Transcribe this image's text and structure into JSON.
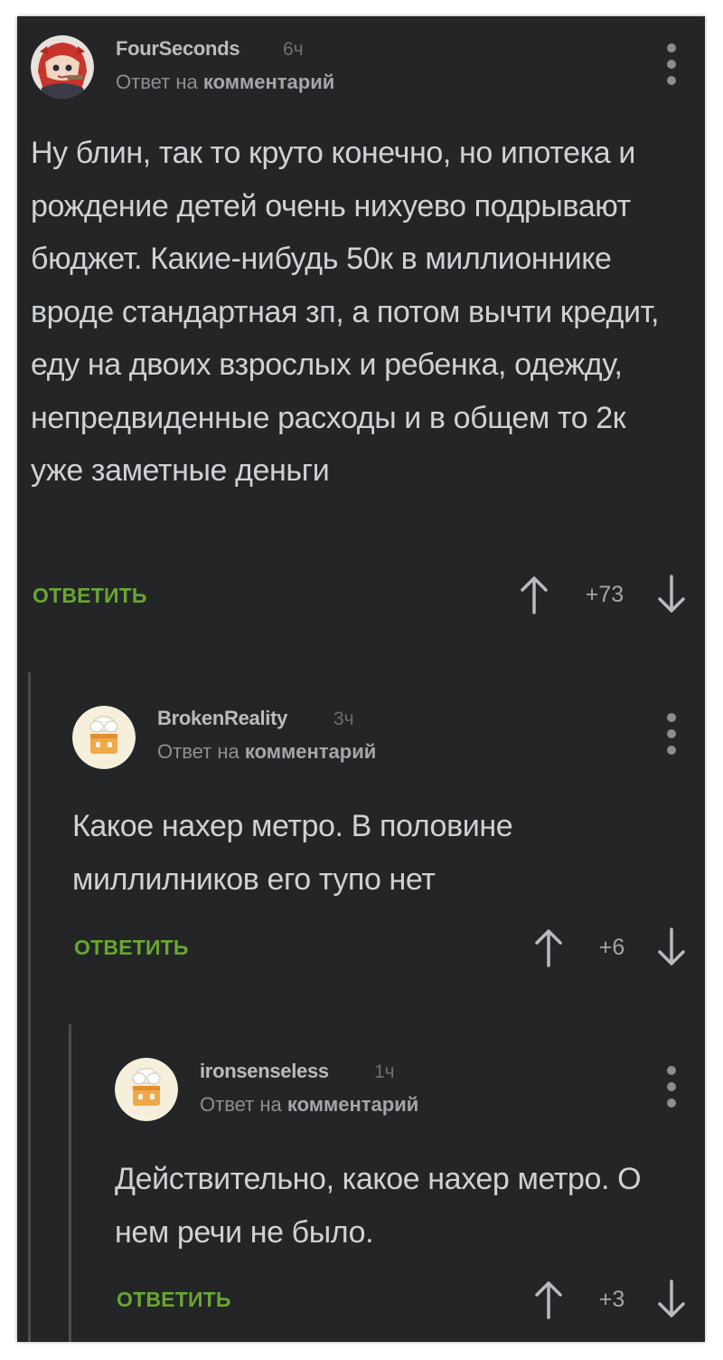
{
  "comments": [
    {
      "username": "FourSeconds",
      "time": "6ч",
      "reply_prefix": "Ответ на",
      "reply_target": "комментарий",
      "text": "Ну блин, так то круто конечно, но ипотека и рождение детей очень нихуево подрывают бюджет. Какие-нибудь 50к в миллионнике вроде стандартная зп, а потом вычти кредит,  еду на двоих взрослых и ребенка, одежду, непредвиденные расходы и в общем то 2к уже заметные деньги",
      "reply_label": "ОТВЕТИТЬ",
      "score": "+73",
      "avatar": "anime-avatar-icon"
    },
    {
      "username": "BrokenReality",
      "time": "3ч",
      "reply_prefix": "Ответ на",
      "reply_target": "комментарий",
      "text": "Какое нахер метро. В половине миллилников его тупо нет",
      "reply_label": "ОТВЕТИТЬ",
      "score": "+6",
      "avatar": "default-avatar-icon"
    },
    {
      "username": "ironsenseless",
      "time": "1ч",
      "reply_prefix": "Ответ на",
      "reply_target": "комментарий",
      "text": "Действительно, какое нахер метро. О нем речи не было.",
      "reply_label": "ОТВЕТИТЬ",
      "score": "+3",
      "avatar": "default-avatar-icon"
    }
  ],
  "colors": {
    "background": "#232527",
    "accent_green": "#6aa62f",
    "text": "#cfd2d5",
    "thread_line": "#4a4c4f"
  }
}
